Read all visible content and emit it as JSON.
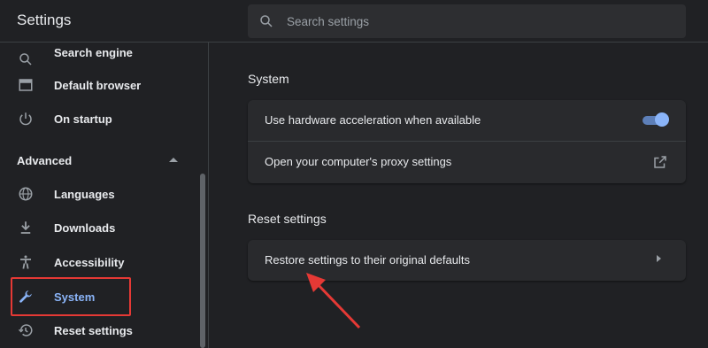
{
  "header": {
    "title": "Settings",
    "search_placeholder": "Search settings"
  },
  "sidebar": {
    "items_top": [
      {
        "label": "Search engine",
        "icon": "search-icon"
      },
      {
        "label": "Default browser",
        "icon": "browser-icon"
      },
      {
        "label": "On startup",
        "icon": "power-icon"
      }
    ],
    "advanced_label": "Advanced",
    "items_advanced": [
      {
        "label": "Languages",
        "icon": "globe-icon"
      },
      {
        "label": "Downloads",
        "icon": "download-icon"
      },
      {
        "label": "Accessibility",
        "icon": "accessibility-icon"
      },
      {
        "label": "System",
        "icon": "wrench-icon",
        "active": true
      },
      {
        "label": "Reset settings",
        "icon": "history-icon"
      }
    ]
  },
  "main": {
    "system": {
      "title": "System",
      "hardware_acceleration_label": "Use hardware acceleration when available",
      "hardware_acceleration_enabled": true,
      "proxy_label": "Open your computer's proxy settings"
    },
    "reset": {
      "title": "Reset settings",
      "restore_label": "Restore settings to their original defaults"
    }
  },
  "colors": {
    "background": "#202124",
    "card": "#292a2d",
    "accent": "#8ab4f8",
    "highlight": "#e53935"
  }
}
